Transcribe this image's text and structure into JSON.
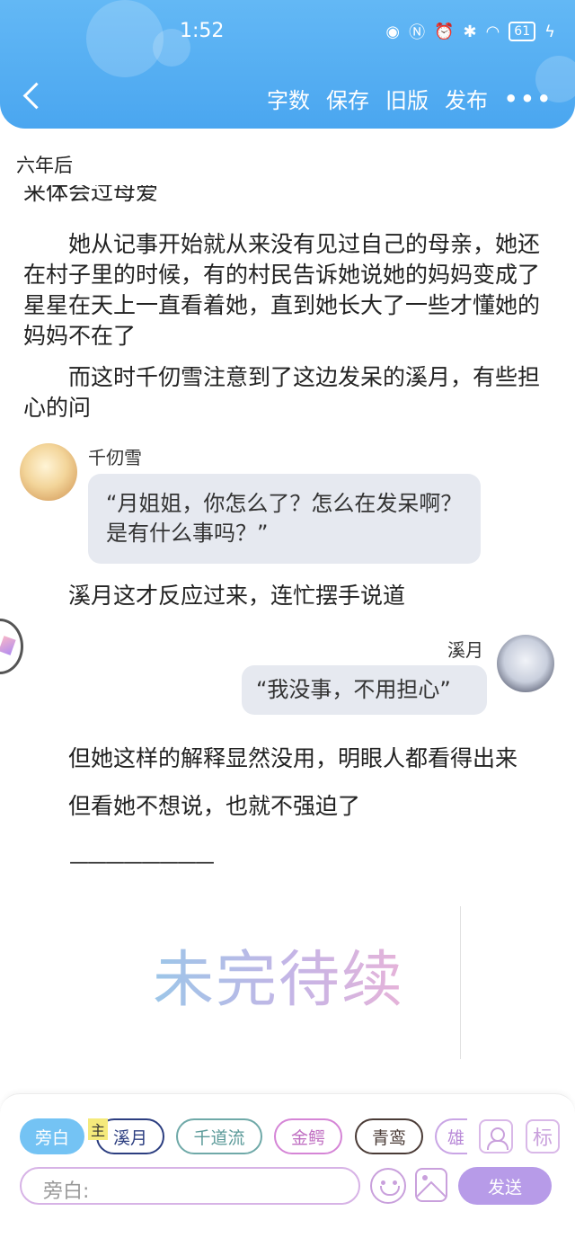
{
  "status_bar": {
    "time": "1:52",
    "battery": "61"
  },
  "header": {
    "actions": {
      "word_count": "字数",
      "save": "保存",
      "old_version": "旧版",
      "publish": "发布",
      "more": "•••"
    }
  },
  "content": {
    "chapter_title": "六年后",
    "cut_off_line": "来体会过母爱",
    "paragraphs": [
      "她从记事开始就从来没有见过自己的母亲，她还在村子里的时候，有的村民告诉她说她的妈妈变成了星星在天上一直看着她，直到她长大了一些才懂她的妈妈不在了",
      "而这时千仞雪注意到了这边发呆的溪月，有些担心的问"
    ],
    "dialogue_1": {
      "speaker": "千仞雪",
      "text": "“月姐姐，你怎么了？怎么在发呆啊？是有什么事吗？”"
    },
    "narration_1": "溪月这才反应过来，连忙摆手说道",
    "dialogue_2": {
      "speaker": "溪月",
      "text": "“我没事，不用担心”"
    },
    "narration_2": "但她这样的解释显然没用，明眼人都看得出来",
    "narration_3": "但看她不想说，也就不强迫了",
    "divider": "————————",
    "tbc_image_text": "未完待续"
  },
  "composer": {
    "roles": [
      "旁白",
      "溪月",
      "千道流",
      "金鳄",
      "青鸾",
      "雄"
    ],
    "main_tag": "主",
    "tag_icon_label": "标",
    "input_placeholder": "旁白:",
    "send_label": "发送"
  }
}
